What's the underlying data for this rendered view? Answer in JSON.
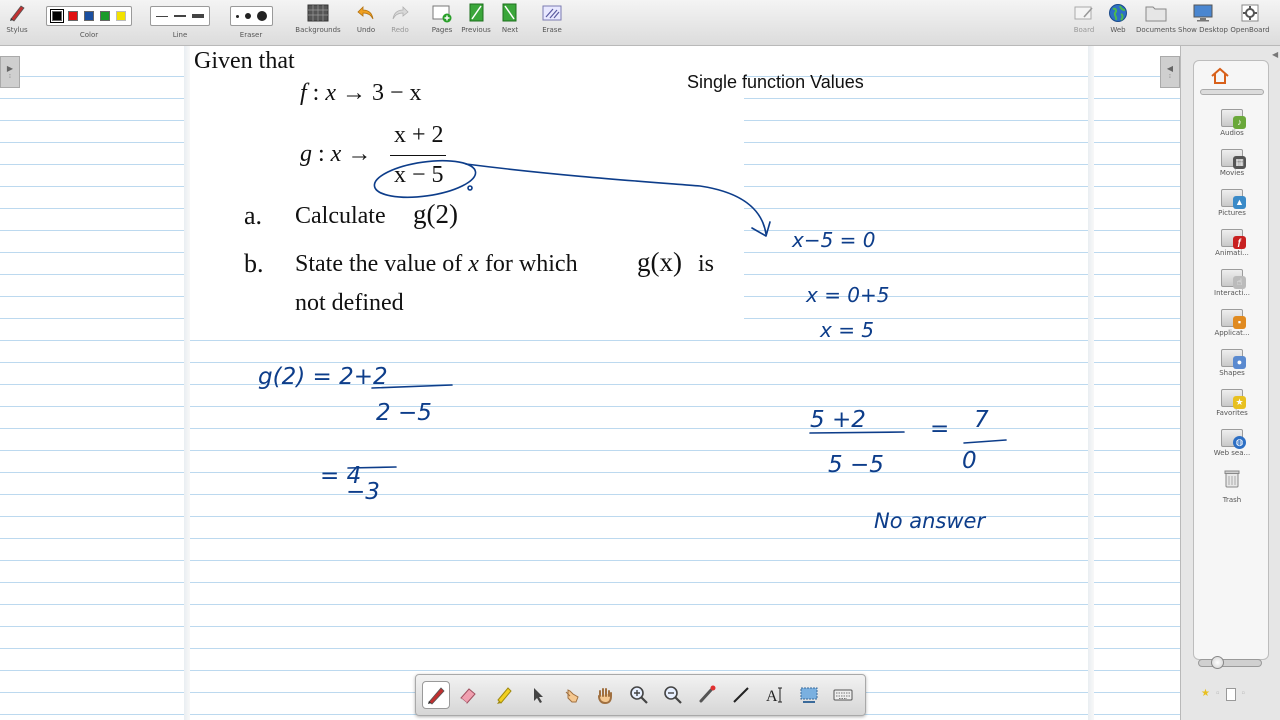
{
  "toolbar": {
    "stylus": "Stylus",
    "color": "Color",
    "line": "Line",
    "eraser": "Eraser",
    "backgrounds": "Backgrounds",
    "undo": "Undo",
    "redo": "Redo",
    "pages": "Pages",
    "previous": "Previous",
    "next": "Next",
    "erase": "Erase",
    "board": "Board",
    "web": "Web",
    "documents": "Documents",
    "show_desktop": "Show Desktop",
    "openboard": "OpenBoard",
    "colors": [
      "#000000",
      "#e01010",
      "#1a4fa0",
      "#1a9a2a",
      "#f2e200"
    ]
  },
  "slide": {
    "title": "Single function Values",
    "given": "Given that",
    "f_def": {
      "f": "f",
      "colon": ":",
      "x": "x",
      "arrow": "→",
      "expr": "3 − x"
    },
    "g_def": {
      "g": "g",
      "colon": ":",
      "x": "x",
      "arrow": "→",
      "numerator": "x + 2",
      "denominator": "x − 5"
    },
    "part_a": {
      "label": "a.",
      "text": "Calculate",
      "math": "g(2)"
    },
    "part_b": {
      "label": "b.",
      "text1": "State the value of",
      "x": "x",
      "text2": "for which",
      "math": "g(x)",
      "text3": "is",
      "line2": "not defined"
    }
  },
  "handwriting": {
    "work_a_1": "g(2) = 2+2",
    "work_a_den": "2 −5",
    "work_a_2": "= 4",
    "work_a_den2": "−3",
    "work_b_1": "x−5 = 0",
    "work_b_2": "x = 0+5",
    "work_b_3": "x = 5",
    "check_num": "5 +2",
    "check_den": "5 −5",
    "check_eq": "=",
    "check_res_num": "7",
    "check_res_den": "0",
    "no_answer": "No answer",
    "ink_color": "#0d3d8a"
  },
  "library": {
    "items": [
      "Audios",
      "Movies",
      "Pictures",
      "Animati...",
      "Interacti...",
      "Applicat...",
      "Shapes",
      "Favorites",
      "Web sea...",
      "Trash"
    ]
  }
}
